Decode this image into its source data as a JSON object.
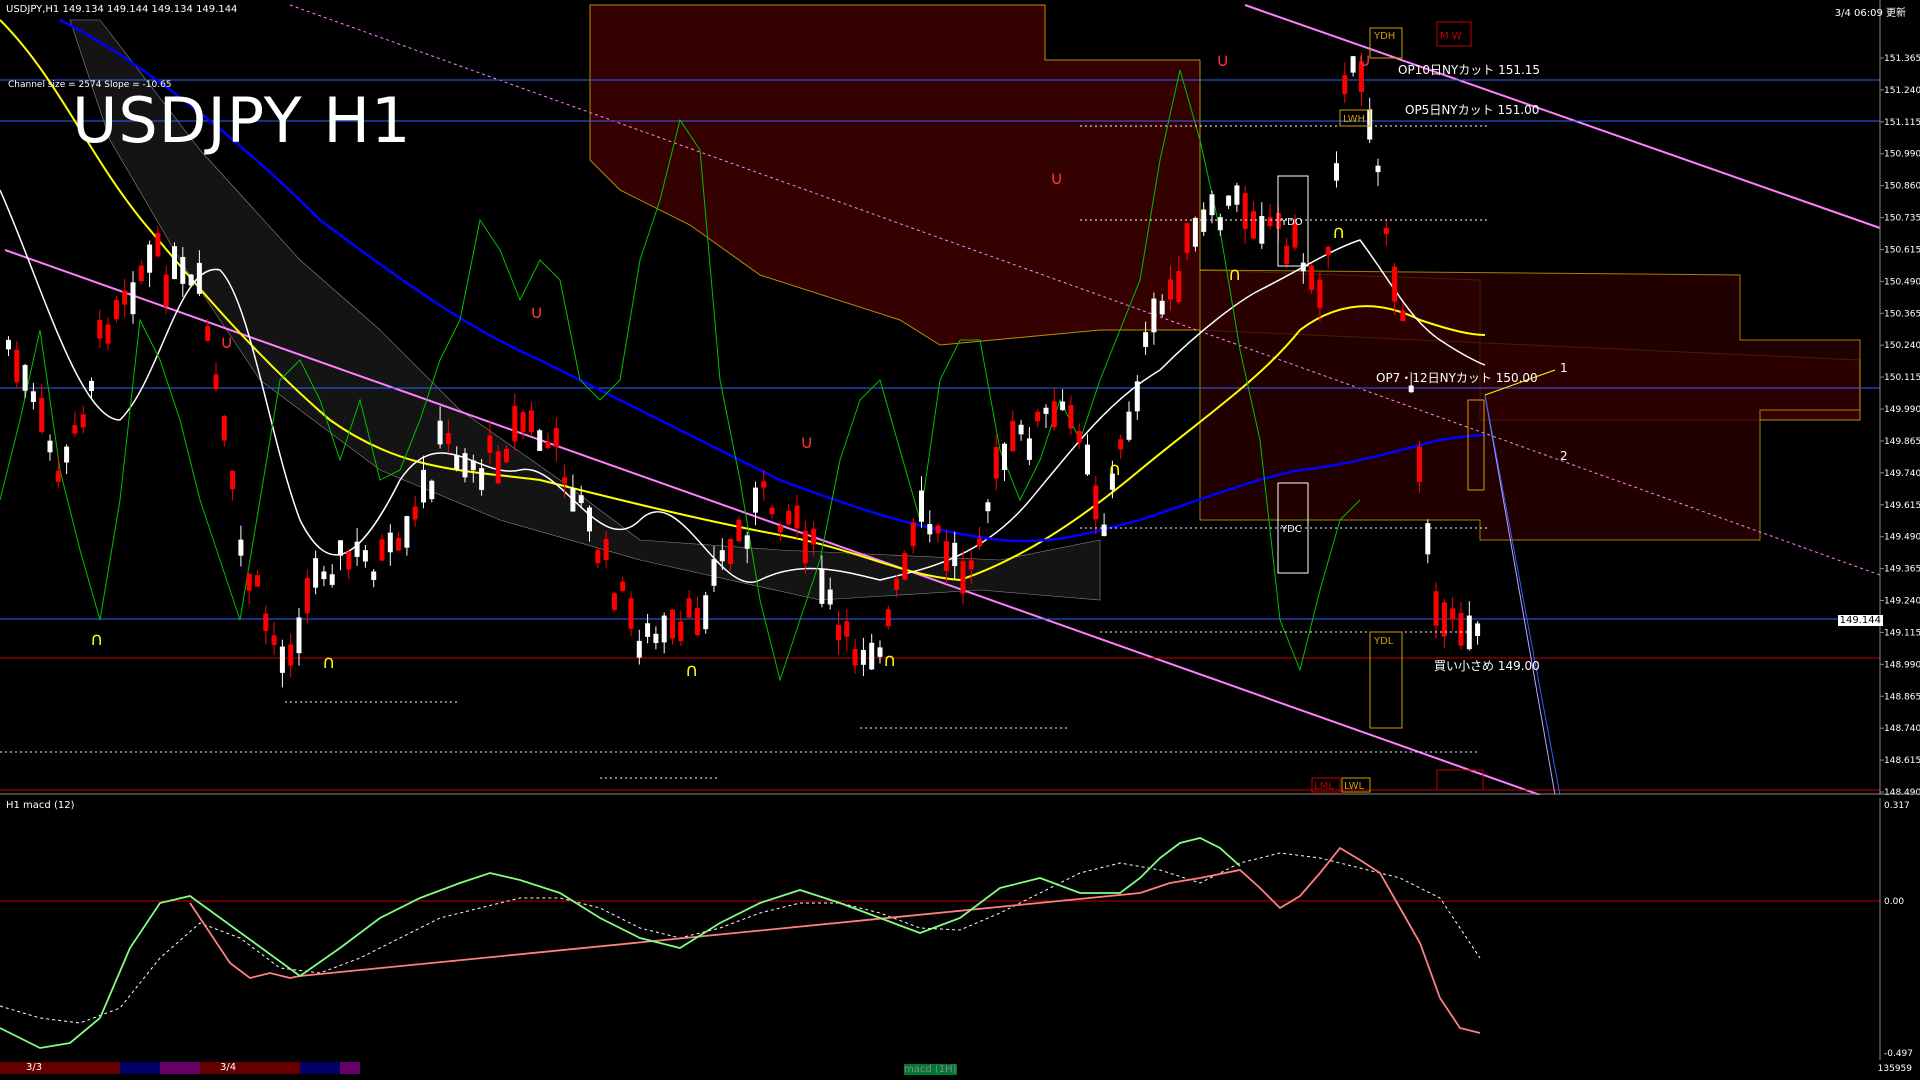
{
  "header": {
    "symbol_info": "USDJPY,H1 149.134 149.144 149.134 149.144",
    "timestamp": "3/4 06:09 更新",
    "channel_info": "Channel size = 2574 Slope = -10.65",
    "big_title": "USDJPY H1"
  },
  "price_axis": {
    "labels": [
      "151.365",
      "151.240",
      "151.115",
      "150.990",
      "150.860",
      "150.735",
      "150.615",
      "150.490",
      "150.365",
      "150.240",
      "150.115",
      "149.990",
      "149.865",
      "149.740",
      "149.615",
      "149.490",
      "149.365",
      "149.240",
      "149.115",
      "148.990",
      "148.865",
      "148.740",
      "148.615",
      "148.490"
    ],
    "current_price": "149.144"
  },
  "annotations": {
    "op10": "OP10日NYカット 151.15",
    "op5": "OP5日NYカット 151.00",
    "op7": "OP7・12日NYカット 150.00",
    "buy": "買い小さめ 149.00",
    "ydh": "YDH",
    "ydo": "YDO",
    "ydc": "YDC",
    "ydl": "YDL",
    "lwh": "LWH",
    "lml": "LML",
    "lwl": "LWL",
    "mw": "M W",
    "wave1": "1",
    "wave2": "2"
  },
  "macd": {
    "label": "H1 macd (12)",
    "axis": [
      "0.317",
      "0.00",
      "-0.497"
    ],
    "footer_value": "135959"
  },
  "bottom": {
    "date1": "3/3",
    "date2": "3/4",
    "indicator_label": "macd (1H)"
  },
  "colors": {
    "candle_up": "#ffffff",
    "candle_down": "#ff0000",
    "ma_white": "#ffffff",
    "ma_yellow": "#ffff00",
    "ma_blue": "#0000ff",
    "chikou": "#00c000",
    "channel": "#ff80ff",
    "cloud_red": "#c00000",
    "cloud_white": "#ffffff",
    "macd_up": "#80ff80",
    "macd_down": "#ff8080",
    "grid_blue": "#3060ff"
  }
}
